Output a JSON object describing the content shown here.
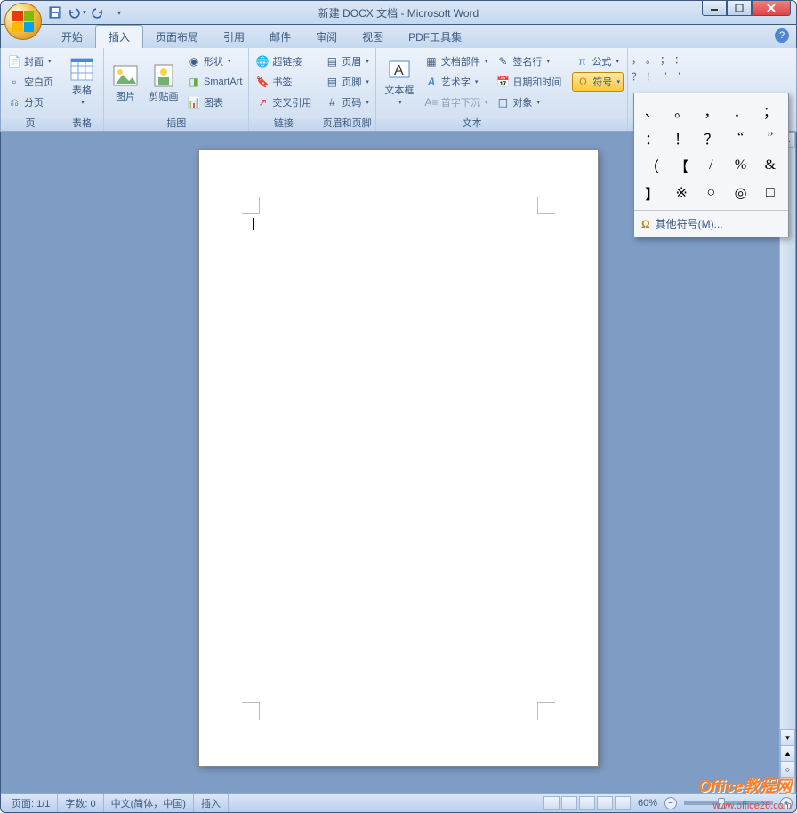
{
  "title": "新建 DOCX 文档 - Microsoft Word",
  "tabs": [
    "开始",
    "插入",
    "页面布局",
    "引用",
    "邮件",
    "审阅",
    "视图",
    "PDF工具集"
  ],
  "active_tab": 1,
  "ribbon": {
    "groups": [
      {
        "label": "页",
        "items": [
          {
            "t": "封面",
            "dd": true
          },
          {
            "t": "空白页"
          },
          {
            "t": "分页"
          }
        ]
      },
      {
        "label": "表格",
        "big": [
          {
            "t": "表格",
            "dd": true
          }
        ]
      },
      {
        "label": "插图",
        "big": [
          {
            "t": "图片"
          },
          {
            "t": "剪贴画"
          }
        ],
        "col": [
          {
            "t": "形状",
            "dd": true
          },
          {
            "t": "SmartArt"
          },
          {
            "t": "图表"
          }
        ]
      },
      {
        "label": "链接",
        "col": [
          {
            "t": "超链接"
          },
          {
            "t": "书签"
          },
          {
            "t": "交叉引用"
          }
        ]
      },
      {
        "label": "页眉和页脚",
        "col": [
          {
            "t": "页眉",
            "dd": true
          },
          {
            "t": "页脚",
            "dd": true
          },
          {
            "t": "页码",
            "dd": true
          }
        ]
      },
      {
        "label": "文本",
        "big": [
          {
            "t": "文本框",
            "dd": true
          }
        ],
        "col1": [
          {
            "t": "文档部件",
            "dd": true
          },
          {
            "t": "艺术字",
            "dd": true
          },
          {
            "t": "首字下沉",
            "dd": true
          }
        ],
        "col2": [
          {
            "t": "签名行",
            "dd": true
          },
          {
            "t": "日期和时间"
          },
          {
            "t": "对象",
            "dd": true
          }
        ]
      },
      {
        "label": "",
        "col": [
          {
            "t": "公式",
            "dd": true
          },
          {
            "t": "符号",
            "dd": true,
            "active": true
          }
        ]
      },
      {
        "label": "",
        "punct": [
          "，",
          "。",
          "；",
          "：",
          "？",
          "！",
          "\"",
          "'"
        ]
      }
    ]
  },
  "symbol_dropdown": {
    "grid": [
      "、",
      "。",
      "，",
      "．",
      "；",
      "：",
      "！",
      "？",
      "“",
      "”",
      "（",
      "【",
      "/",
      "%",
      "&",
      "】",
      "※",
      "○",
      "◎",
      "□"
    ],
    "more": "其他符号(M)..."
  },
  "status": {
    "page": "页面: 1/1",
    "words": "字数: 0",
    "lang": "中文(简体，中国)",
    "mode": "插入",
    "zoom": "60%"
  },
  "watermark": "Office教程网",
  "watermark2": "www.office26.com"
}
